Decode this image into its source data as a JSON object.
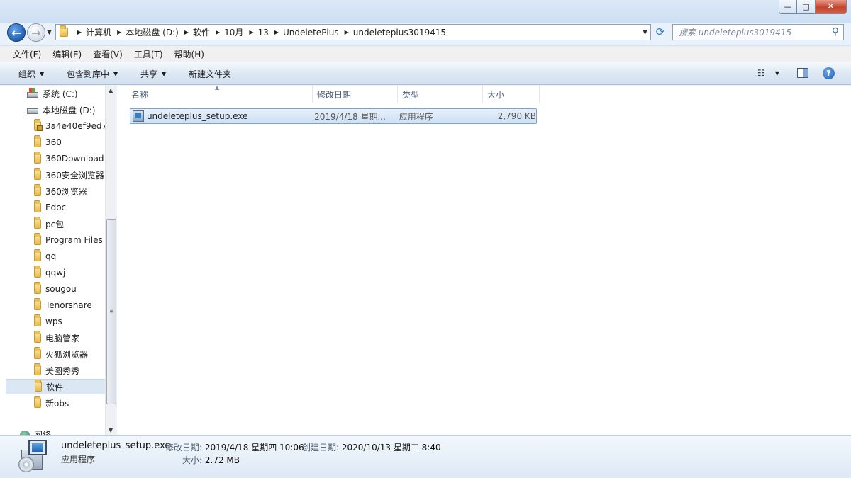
{
  "window": {
    "minimize_glyph": "—",
    "maximize_glyph": "□",
    "close_glyph": "✕"
  },
  "nav": {
    "back_glyph": "←",
    "forward_glyph": "→"
  },
  "address": {
    "breadcrumbs": [
      "计算机",
      "本地磁盘 (D:)",
      "软件",
      "10月",
      "13",
      "UndeletePlus",
      "undeleteplus3019415"
    ]
  },
  "search": {
    "placeholder": "搜索 undeleteplus3019415"
  },
  "menu": [
    "文件(F)",
    "编辑(E)",
    "查看(V)",
    "工具(T)",
    "帮助(H)"
  ],
  "toolbar": {
    "organize": "组织",
    "include_in_library": "包含到库中",
    "share": "共享",
    "new_folder": "新建文件夹",
    "help_glyph": "?"
  },
  "navpane": {
    "drives": [
      {
        "label": "系统 (C:)"
      },
      {
        "label": "本地磁盘 (D:)"
      }
    ],
    "folders": [
      "3a4e40ef9ed7",
      "360",
      "360Download",
      "360安全浏览器",
      "360浏览器",
      "Edoc",
      "pc包",
      "Program Files",
      "qq",
      "qqwj",
      "sougou",
      "Tenorshare",
      "wps",
      "电脑管家",
      "火狐浏览器",
      "美图秀秀",
      "软件",
      "新obs"
    ],
    "selected_folder": "软件",
    "network": "网络"
  },
  "columns": {
    "name": "名称",
    "modified": "修改日期",
    "type": "类型",
    "size": "大小"
  },
  "files": [
    {
      "name": "undeleteplus_setup.exe",
      "modified": "2019/4/18 星期...",
      "type": "应用程序",
      "size": "2,790 KB"
    }
  ],
  "details": {
    "name": "undeleteplus_setup.exe",
    "type": "应用程序",
    "modified_label": "修改日期:",
    "modified_value": "2019/4/18 星期四 10:06",
    "created_label": "创建日期:",
    "created_value": "2020/10/13 星期二 8:40",
    "size_label": "大小:",
    "size_value": "2.72 MB"
  }
}
